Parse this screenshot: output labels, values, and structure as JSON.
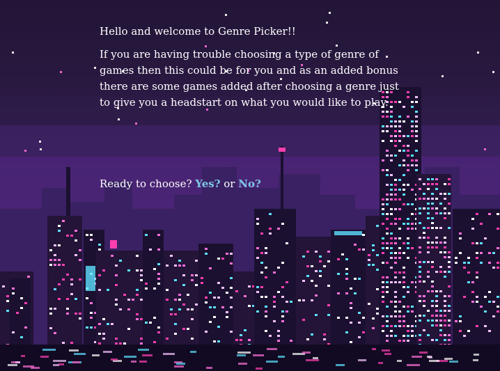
{
  "intro": {
    "greeting": "Hello and welcome to Genre Picker!!",
    "description": "If you are having trouble choosing a type of genre of games then this could be for you and as an added bonus there are some games added after choosing a genre just to give you a headstart on what you would like to play."
  },
  "prompt": {
    "question": "Ready to choose?",
    "yes_label": "Yes?",
    "separator": "or",
    "no_label": "No?"
  },
  "colors": {
    "text": "#ffffff",
    "link": "#7ec9e6",
    "sky_dark": "#221536",
    "sky_purple": "#4a2478"
  }
}
